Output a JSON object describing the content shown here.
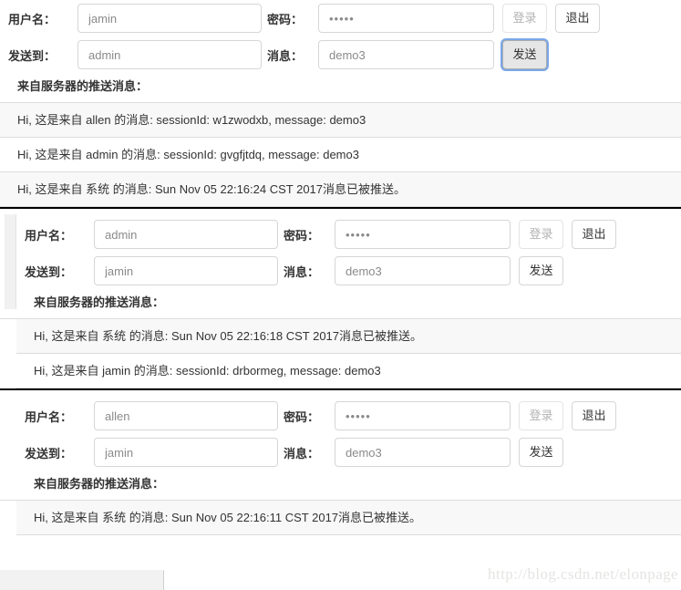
{
  "form_labels": {
    "username": "用户名：",
    "password": "密码：",
    "send_to": "发送到：",
    "message": "消息：",
    "login": "登录",
    "logout": "退出",
    "send": "发送"
  },
  "push_heading": "来自服务器的推送消息：",
  "panels": [
    {
      "id": "panel-jamin",
      "username": "jamin",
      "password": "•••••",
      "send_to": "admin",
      "message": "demo3",
      "send_button_focused": true,
      "login_disabled": true,
      "has_scroll_strip": false,
      "messages": [
        "Hi, 这是来自 allen 的消息: sessionId: w1zwodxb, message: demo3",
        "Hi, 这是来自 admin 的消息: sessionId: gvgfjtdq, message: demo3",
        "Hi, 这是来自 系统 的消息: Sun Nov 05 22:16:24 CST 2017消息已被推送。"
      ]
    },
    {
      "id": "panel-admin",
      "username": "admin",
      "password": "•••••",
      "send_to": "jamin",
      "message": "demo3",
      "send_button_focused": false,
      "login_disabled": true,
      "has_scroll_strip": true,
      "messages": [
        "Hi, 这是来自 系统 的消息: Sun Nov 05 22:16:18 CST 2017消息已被推送。",
        "Hi, 这是来自 jamin 的消息: sessionId: drbormeg, message: demo3"
      ]
    },
    {
      "id": "panel-allen",
      "username": "allen",
      "password": "•••••",
      "send_to": "jamin",
      "message": "demo3",
      "send_button_focused": false,
      "login_disabled": true,
      "has_scroll_strip": false,
      "messages": [
        "Hi, 这是来自 系统 的消息: Sun Nov 05 22:16:11 CST 2017消息已被推送。"
      ]
    }
  ],
  "watermark": "http://blog.csdn.net/elonpage",
  "colors": {
    "focus_ring": "#7aa7e8",
    "divider": "#000000",
    "row_stripe": "#f8f8f8",
    "border": "#dddddd"
  }
}
